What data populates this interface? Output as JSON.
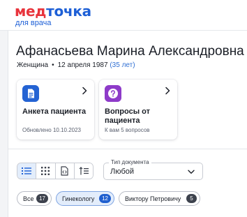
{
  "header": {
    "logo_part1": "мед",
    "logo_part2": "точка",
    "logo_subtitle": "для врача"
  },
  "patient": {
    "name": "Афанасьева Марина Александровна",
    "gender": "Женщина",
    "birth_date": "12 апреля 1987",
    "age": "(35 лет)"
  },
  "cards": [
    {
      "title": "Анкета пациента",
      "subtitle": "Обновлено 10.10.2023",
      "icon": "document-icon",
      "icon_color": "#2463d3"
    },
    {
      "title": "Вопросы от пациента",
      "subtitle": "К вам 5 вопросов",
      "icon": "question-icon",
      "icon_color": "#8e3bc9"
    }
  ],
  "view_toggles": [
    {
      "icon": "list-view-icon",
      "active": true
    },
    {
      "icon": "grid-view-icon",
      "active": false
    },
    {
      "icon": "document-view-icon",
      "active": false
    },
    {
      "icon": "timeline-view-icon",
      "active": false
    }
  ],
  "document_type": {
    "label": "Тип документа",
    "value": "Любой"
  },
  "filters": [
    {
      "label": "Все",
      "count": "17",
      "active": false
    },
    {
      "label": "Гинекологу",
      "count": "12",
      "active": true
    },
    {
      "label": "Виктору Петровичу",
      "count": "5",
      "active": false
    }
  ],
  "colors": {
    "accent": "#1d5fd6",
    "logo_red": "#e8343c",
    "age_text": "#2f6fd3",
    "chip_active_bg": "#e3edfb"
  }
}
